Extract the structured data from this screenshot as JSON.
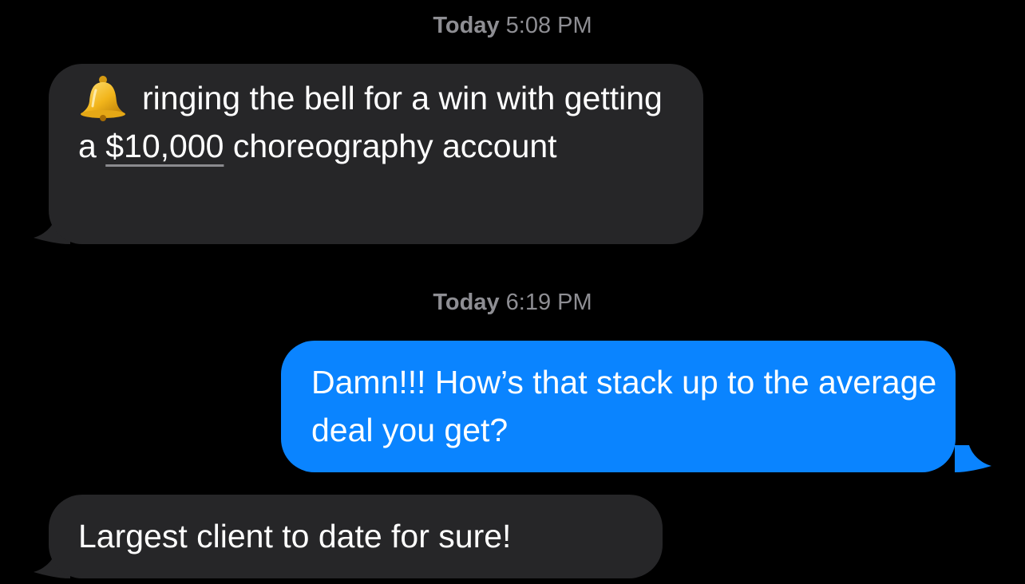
{
  "thread": {
    "timestamp_1": {
      "day": "Today",
      "time": "5:08 PM"
    },
    "message_1": {
      "sender": "incoming",
      "icon": "bell-emoji",
      "text_before": "ringing the bell for a win with getting a",
      "amount": "$10,000",
      "text_after": "choreography account"
    },
    "timestamp_2": {
      "day": "Today",
      "time": "6:19 PM"
    },
    "message_2": {
      "sender": "outgoing",
      "text": "Damn!!! How’s that stack up to the average deal you get?"
    },
    "message_3": {
      "sender": "incoming",
      "text": "Largest client to date for sure!"
    }
  },
  "colors": {
    "background": "#000000",
    "incoming_bubble": "#262628",
    "outgoing_bubble": "#0a84ff",
    "timestamp_text": "#8e8e93",
    "message_text": "#ffffff"
  }
}
